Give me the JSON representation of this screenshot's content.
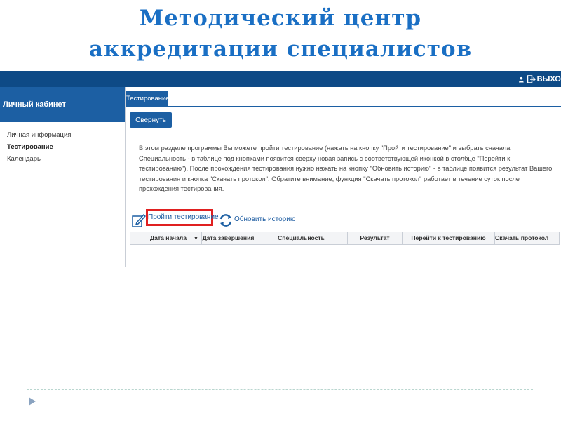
{
  "slide": {
    "title_line1": "Методический центр",
    "title_line2": "аккредитации специалистов"
  },
  "topbar": {
    "user_icon": "user-icon",
    "logout_icon": "logout-icon",
    "logout_label": "ВЫХО"
  },
  "sidebar": {
    "header": "Личный кабинет",
    "items": [
      {
        "label": "Личная информация",
        "active": false
      },
      {
        "label": "Тестирование",
        "active": true
      },
      {
        "label": "Календарь",
        "active": false
      }
    ]
  },
  "main": {
    "tab_label": "Тестирование",
    "collapse_label": "Свернуть",
    "description": "В этом разделе программы Вы можете пройти тестирование (нажать на кнопку \"Пройти тестирование\" и выбрать сначала Специальность - в таблице под кнопками появится сверху новая запись с соответствующей иконкой в столбце \"Перейти к тестированию\"). После прохождения тестирования нужно нажать на кнопку \"Обновить историю\" - в таблице появится результат Вашего тестирования и кнопка \"Скачать протокол\". Обратите внимание, функция \"Скачать протокол\" работает в течение суток после прохождения тестирования.",
    "take_test_label": "Пройти тестирование",
    "refresh_label": "Обновить историю",
    "table": {
      "columns": [
        "Дата начала",
        "Дата завершения",
        "Специальность",
        "Результат",
        "Перейти к тестированию",
        "Скачать протокол"
      ]
    }
  },
  "colors": {
    "title": "#1a6fc4",
    "primary": "#1c5fa3",
    "topbar": "#0e4a86",
    "highlight": "#e02020",
    "link": "#1a5aa0"
  }
}
